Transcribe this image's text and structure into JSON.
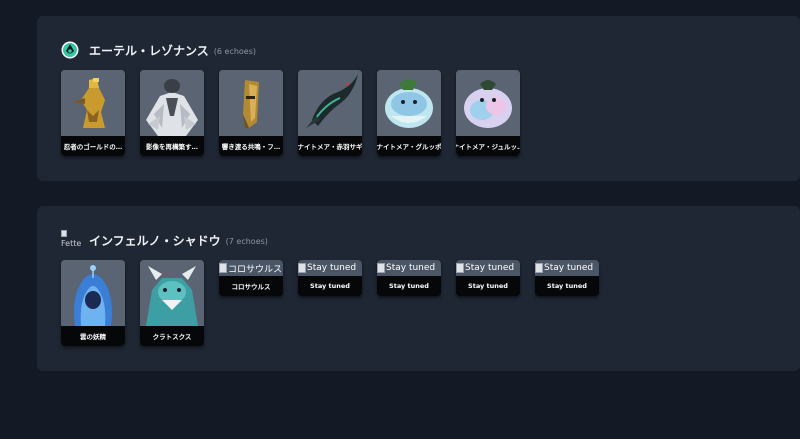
{
  "sections": [
    {
      "title": "エーテル・レゾナンス",
      "count": "(6 echoes)",
      "icon": "aether-resonance-icon",
      "accent": "#33c8a5",
      "cards": [
        {
          "label": "忍者のゴールドの…",
          "art": "golden-ninja"
        },
        {
          "label": "影像を再構築す…",
          "art": "feathered-warrior"
        },
        {
          "label": "響き渡る共鳴・フ…",
          "art": "golden-mask"
        },
        {
          "label": "ナイトメア・赤羽サギ",
          "art": "dark-heron"
        },
        {
          "label": "ナイトメア・グルッポ",
          "art": "blue-puffball"
        },
        {
          "label": "ナイトメア・ジュルッ…",
          "art": "pearl-puffball"
        }
      ]
    },
    {
      "title": "インフェルノ・シャドウ",
      "count": "(7 echoes)",
      "icon_alt": "Fette",
      "cards": [
        {
          "label": "雲の妖精",
          "art": "cloud-fairy"
        },
        {
          "label": "クラトスクス",
          "art": "cyan-dragon"
        },
        {
          "label": "コロサウルス",
          "alt": "コロサウルス",
          "broken": true
        },
        {
          "label": "Stay tuned",
          "alt": "Stay tuned",
          "broken": true
        },
        {
          "label": "Stay tuned",
          "alt": "Stay tuned",
          "broken": true
        },
        {
          "label": "Stay tuned",
          "alt": "Stay tuned",
          "broken": true
        },
        {
          "label": "Stay tuned",
          "alt": "Stay tuned",
          "broken": true
        }
      ]
    }
  ]
}
